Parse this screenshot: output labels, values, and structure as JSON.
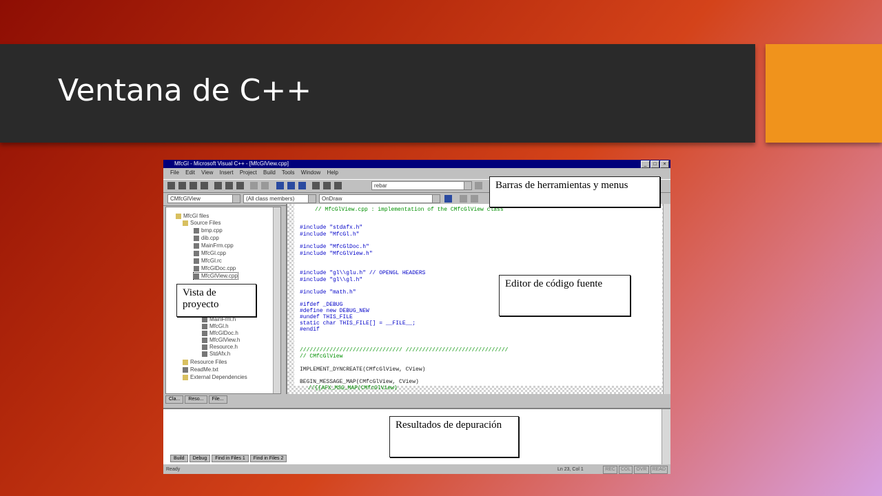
{
  "slide": {
    "title": "Ventana de C++",
    "colors": {
      "title_bar": "#2a2a2a",
      "accent": "#f0931c",
      "background_start": "#8e0e04",
      "background_end": "#d7a0e0"
    }
  },
  "window": {
    "title": "MfcGl - Microsoft Visual C++ - [MfcGlView.cpp]",
    "controls": [
      "_",
      "□",
      "×"
    ],
    "menu": [
      "File",
      "Edit",
      "View",
      "Insert",
      "Project",
      "Build",
      "Tools",
      "Window",
      "Help"
    ],
    "find_combo": "rebar",
    "class_combo": "CMfcGlView",
    "members_combo": "(All class members)",
    "function_combo": "OnDraw"
  },
  "project_tree": {
    "items": [
      "MfcGl files",
      "Source Files",
      "bmp.cpp",
      "dib.cpp",
      "MainFrm.cpp",
      "MfcGl.cpp",
      "MfcGl.rc",
      "MfcGlDoc.cpp",
      "MfcGlView.cpp",
      "MainFrm.h",
      "MfcGl.h",
      "MfcGlDoc.h",
      "MfcGlView.h",
      "Resource.h",
      "StdAfx.h",
      "Resource Files",
      "ReadMe.txt",
      "External Dependencies"
    ],
    "tabs": [
      "Cla...",
      "Reso...",
      "File..."
    ]
  },
  "editor": {
    "lines": [
      {
        "text": "// MfcGlView.cpp : implementation of the CMfcGlView class",
        "style": "cm"
      },
      {
        "text": "#include \"stdafx.h\"",
        "style": "kw"
      },
      {
        "text": "#include \"MfcGl.h\"",
        "style": "kw"
      },
      {
        "text": "#include \"MfcGlDoc.h\"",
        "style": "kw"
      },
      {
        "text": "#include \"MfcGlView.h\"",
        "style": "kw"
      },
      {
        "text": "#include \"gl\\\\glu.h\" // OPENGL HEADERS",
        "style": "kw"
      },
      {
        "text": "#include \"gl\\\\gl.h\"",
        "style": "kw"
      },
      {
        "text": "#include \"math.h\"",
        "style": "kw"
      },
      {
        "text": "#ifdef _DEBUG",
        "style": "kw"
      },
      {
        "text": "#define new DEBUG_NEW",
        "style": "kw"
      },
      {
        "text": "#undef THIS_FILE",
        "style": "kw"
      },
      {
        "text": "static char THIS_FILE[] = __FILE__;",
        "style": "kw"
      },
      {
        "text": "#endif",
        "style": "kw"
      },
      {
        "text": "/////////////////////////////// ///////////////////////////////",
        "style": "cm"
      },
      {
        "text": "// CMfcGlView",
        "style": "cm"
      },
      {
        "text": "IMPLEMENT_DYNCREATE(CMfcGlView, CView)",
        "style": "tx"
      },
      {
        "text": "BEGIN_MESSAGE_MAP(CMfcGlView, CView)",
        "style": "tx"
      },
      {
        "text": "//{{AFX_MSG_MAP(CMfcGlView)",
        "style": "cm"
      }
    ]
  },
  "output": {
    "tabs": [
      "Build",
      "Debug",
      "Find in Files 1",
      "Find in Files 2"
    ]
  },
  "status": {
    "left": "Ready",
    "position": "Ln 23, Col 1",
    "indicators": [
      "REC",
      "COL",
      "OVR",
      "READ"
    ]
  },
  "callouts": {
    "toolbars": "Barras de herramientas y menus",
    "project_view": "Vista de proyecto",
    "code_editor": "Editor de código fuente",
    "debug_results": "Resultados de depuración"
  }
}
